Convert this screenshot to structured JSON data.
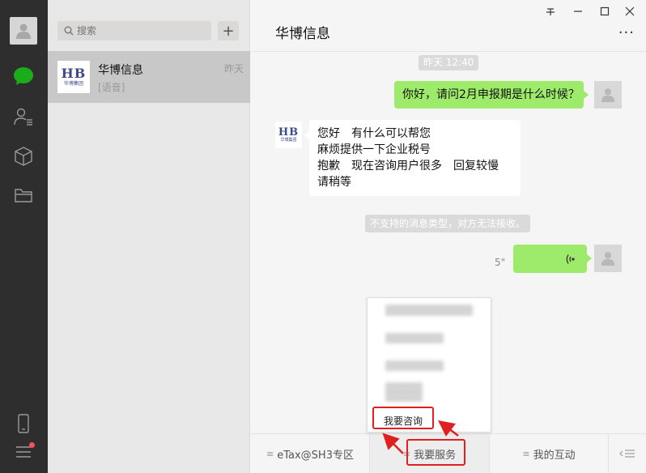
{
  "search": {
    "placeholder": "搜索"
  },
  "add_button": {
    "label": "+"
  },
  "chat_list": [
    {
      "name": "华博信息",
      "preview": "[语音]",
      "time": "昨天",
      "logo_text": "HB",
      "logo_sub": "华博集团"
    }
  ],
  "chat": {
    "title": "华博信息",
    "more": "···",
    "timestamp": "昨天 12:40",
    "messages": [
      {
        "from": "me",
        "text": "你好，请问2月申报期是什么时候？"
      },
      {
        "from": "them",
        "lines": [
          "您好　有什么可以帮您",
          "麻烦提供一下企业税号",
          "抱歉　现在咨询用户很多　回复较慢",
          "请稍等"
        ]
      },
      {
        "from": "system",
        "text": "不支持的消息类型，对方无法接收。"
      },
      {
        "from": "me",
        "type": "voice",
        "duration": "5\""
      }
    ]
  },
  "popup_menu": {
    "visible_item": "我要咨询"
  },
  "bottom_menu": [
    {
      "label": "eTax@SH3专区"
    },
    {
      "label": "我要服务"
    },
    {
      "label": "我的互动"
    }
  ],
  "window_controls": [
    "pin",
    "minimize",
    "maximize",
    "close"
  ],
  "colors": {
    "nav_bg": "#2e2e2e",
    "accent_green": "#1aad19",
    "bubble_green": "#9eea6a",
    "highlight_red": "#e02020"
  }
}
